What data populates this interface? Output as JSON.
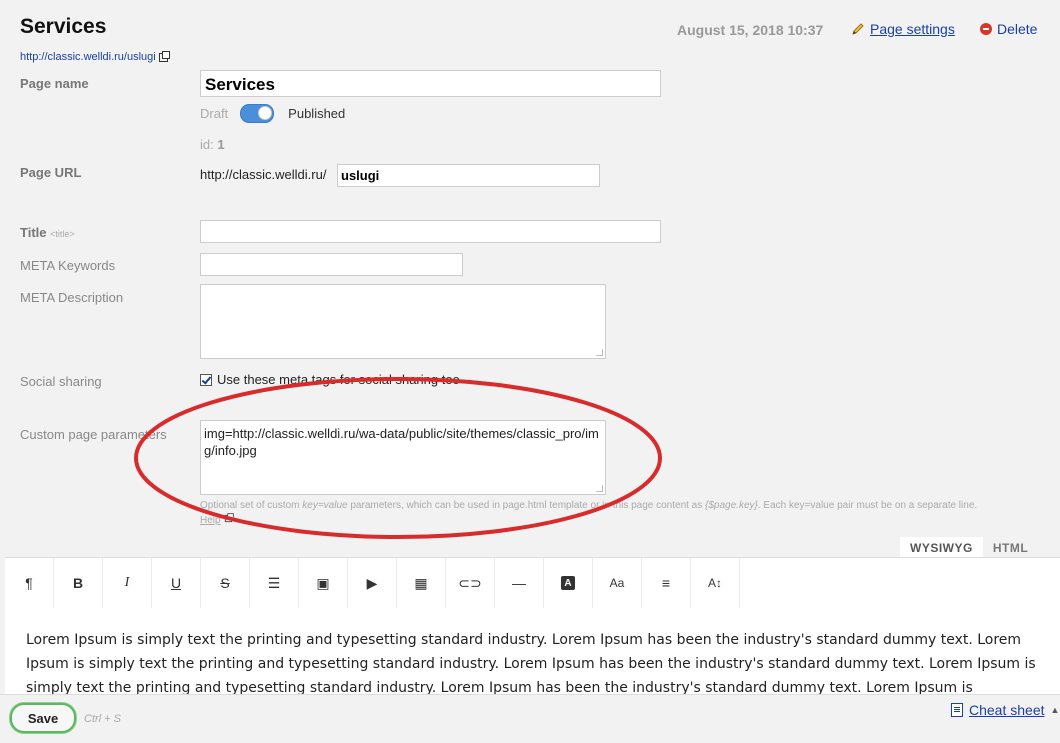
{
  "header": {
    "title": "Services",
    "url": "http://classic.welldi.ru/uslugi",
    "date": "August 15, 2018 10:37",
    "settings_label": "Page settings",
    "delete_label": "Delete"
  },
  "form": {
    "page_name_label": "Page name",
    "page_name_value": "Services",
    "draft_label": "Draft",
    "published_label": "Published",
    "published": true,
    "id_label": "id:",
    "id_value": "1",
    "page_url_label": "Page URL",
    "url_prefix": "http://classic.welldi.ru/",
    "url_value": "uslugi",
    "title_label": "Title",
    "title_tag": "<title>",
    "title_value": "",
    "meta_keywords_label": "META Keywords",
    "meta_keywords_value": "",
    "meta_description_label": "META Description",
    "meta_description_value": "",
    "social_label": "Social sharing",
    "social_checkbox_label": "Use these meta tags for social sharing too",
    "social_checked": true,
    "custom_params_label": "Custom page parameters",
    "custom_params_value": "img=http://classic.welldi.ru/wa-data/public/site/themes/classic_pro/img/info.jpg",
    "hint_part1": "Optional set of custom ",
    "hint_em1": "key=value",
    "hint_part2": " parameters, which can be used in page.html template or in this page content as ",
    "hint_em2": "{$page.key}",
    "hint_part3": ". Each key=value pair must be on a separate line.",
    "help_label": "Help"
  },
  "editor": {
    "tabs": [
      "WYSIWYG",
      "HTML"
    ],
    "active_tab": "WYSIWYG",
    "toolbar": [
      {
        "name": "paragraph-icon",
        "glyph": "¶"
      },
      {
        "name": "bold-icon",
        "glyph": "B"
      },
      {
        "name": "italic-icon",
        "glyph": "I"
      },
      {
        "name": "underline-icon",
        "glyph": "U"
      },
      {
        "name": "strikethrough-icon",
        "glyph": "S"
      },
      {
        "name": "list-icon",
        "glyph": "☰"
      },
      {
        "name": "image-icon",
        "glyph": "▣"
      },
      {
        "name": "video-icon",
        "glyph": "▶"
      },
      {
        "name": "table-icon",
        "glyph": "▦"
      },
      {
        "name": "link-icon",
        "glyph": "⊂⊃"
      },
      {
        "name": "horizontal-rule-icon",
        "glyph": "—"
      },
      {
        "name": "font-color-icon",
        "glyph": "A"
      },
      {
        "name": "font-size-icon",
        "glyph": "Aa"
      },
      {
        "name": "align-icon",
        "glyph": "≡"
      },
      {
        "name": "line-height-icon",
        "glyph": "A↕"
      }
    ],
    "content": "Lorem Ipsum is simply text the printing and typesetting standard industry. Lorem Ipsum has been the industry's standard dummy text. Lorem Ipsum is simply text the printing and typesetting standard industry. Lorem Ipsum has been the industry's standard dummy text. Lorem Ipsum is simply text the printing and typesetting standard industry. Lorem Ipsum has been the industry's standard dummy text. Lorem Ipsum is"
  },
  "footer": {
    "save_label": "Save",
    "shortcut": "Ctrl + S",
    "cheat_sheet_label": "Cheat sheet"
  },
  "colors": {
    "link": "#1a3fa6",
    "annotation": "#d92b2b",
    "toggle": "#4a8fd9",
    "save_outline": "#5cb85c"
  }
}
